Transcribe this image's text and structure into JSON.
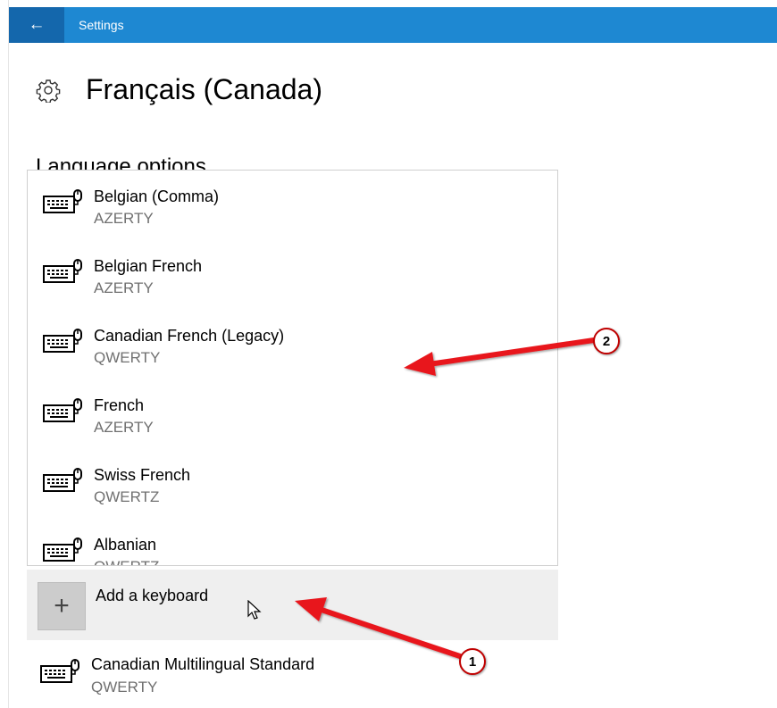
{
  "titlebar": {
    "title": "Settings",
    "back_icon": "←"
  },
  "page": {
    "title": "Français (Canada)",
    "section": "Language options"
  },
  "keyboards": [
    {
      "name": "Belgian (Comma)",
      "layout": "AZERTY"
    },
    {
      "name": "Belgian French",
      "layout": "AZERTY"
    },
    {
      "name": "Canadian French (Legacy)",
      "layout": "QWERTY"
    },
    {
      "name": "French",
      "layout": "AZERTY"
    },
    {
      "name": "Swiss French",
      "layout": "QWERTZ"
    },
    {
      "name": "Albanian",
      "layout": "QWERTZ"
    }
  ],
  "add_keyboard": {
    "label": "Add a keyboard",
    "icon": "+"
  },
  "installed_keyboard": {
    "name": "Canadian Multilingual Standard",
    "layout": "QWERTY"
  },
  "callouts": {
    "one": "1",
    "two": "2"
  },
  "colors": {
    "accent": "#1e88d2",
    "accent_dark": "#1467ac",
    "arrow": "#e8191e"
  }
}
